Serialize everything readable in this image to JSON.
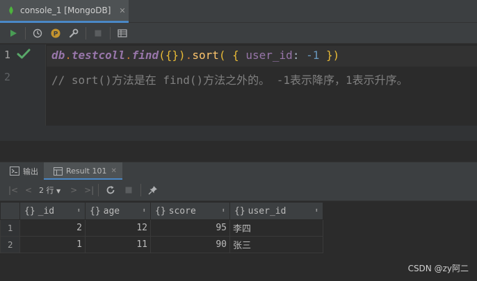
{
  "tab": {
    "title": "console_1 [MongoDB]",
    "close": "✕"
  },
  "toolbar": {
    "icons": [
      "run-icon",
      "history-icon",
      "p-icon",
      "settings-icon",
      "stop-icon",
      "table-icon"
    ]
  },
  "editor": {
    "line_numbers": [
      "1",
      "2"
    ],
    "line1": {
      "db": "db",
      "dot1": ".",
      "coll": "testcoll",
      "dot2": ".",
      "find": "find",
      "find_args": "({})",
      "dot3": ".",
      "sort": "sort",
      "open": "( { ",
      "key": "user_id",
      "colon": ": ",
      "value": "-1",
      "close": " })"
    },
    "line2": "// sort()方法是在 find()方法之外的。 -1表示降序，1表示升序。"
  },
  "panel": {
    "tabs": [
      {
        "label": "输出"
      },
      {
        "label": "Result 101",
        "close": "✕"
      }
    ],
    "rows_label": "2 行"
  },
  "grid": {
    "columns": [
      "_id",
      "age",
      "score",
      "user_id"
    ],
    "brace": "{}",
    "rows": [
      {
        "n": "1",
        "_id": "2",
        "age": "12",
        "score": "95",
        "user_id": "李四"
      },
      {
        "n": "2",
        "_id": "1",
        "age": "11",
        "score": "90",
        "user_id": "张三"
      }
    ]
  },
  "watermark": "CSDN @zy阿二",
  "colors": {
    "accent": "#4a88c7",
    "run": "#499c54",
    "leaf": "#4db33d"
  }
}
